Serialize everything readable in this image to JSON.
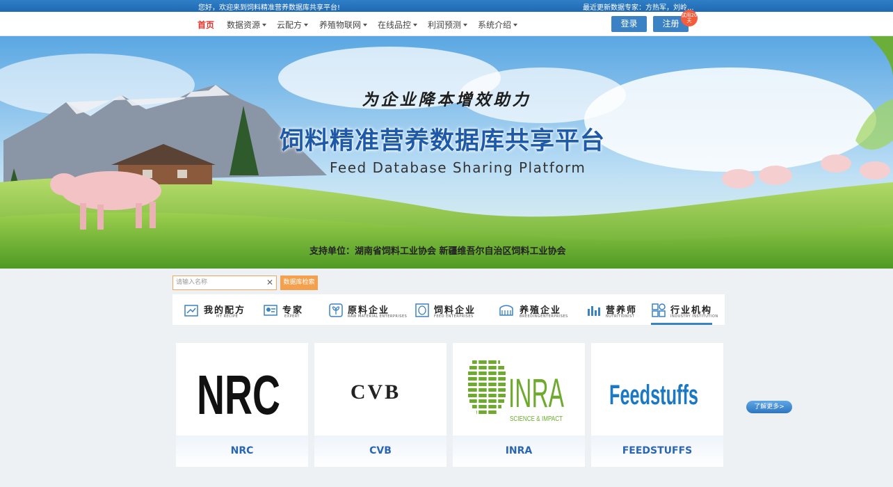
{
  "topbar": {
    "welcome": "您好，欢迎来到饲料精准营养数据库共享平台!",
    "experts": "最近更新数据专家：方热军，刘岭..."
  },
  "nav": {
    "items": [
      {
        "label": "首页",
        "active": true,
        "dropdown": false
      },
      {
        "label": "数据资源",
        "dropdown": true
      },
      {
        "label": "云配方",
        "dropdown": true
      },
      {
        "label": "养殖物联网",
        "dropdown": true
      },
      {
        "label": "在线品控",
        "dropdown": true
      },
      {
        "label": "利润预测",
        "dropdown": true
      },
      {
        "label": "系统介绍",
        "dropdown": true
      }
    ],
    "login": "登录",
    "register": "注册",
    "trial_badge": "试用20天"
  },
  "banner": {
    "slogan": "为企业降本增效助力",
    "platform_name": "饲料精准营养数据库共享平台",
    "english_name": "Feed Database Sharing Platform",
    "support": "支持单位：湖南省饲料工业协会 新疆维吾尔自治区饲料工业协会"
  },
  "search": {
    "placeholder": "请输入名称",
    "button": "数据库检索"
  },
  "tabs": [
    {
      "zh": "我的配方",
      "en": "MY RECIPE",
      "icon": "recipe-icon"
    },
    {
      "zh": "专家",
      "en": "EXPERT",
      "icon": "expert-icon"
    },
    {
      "zh": "原料企业",
      "en": "RAW MATERIAL ENTERPRISES",
      "icon": "raw-material-icon"
    },
    {
      "zh": "饲料企业",
      "en": "FEED ENTERPRISES",
      "icon": "feed-icon"
    },
    {
      "zh": "养殖企业",
      "en": "BREEDINGENTERPRISES",
      "icon": "breeding-icon"
    },
    {
      "zh": "营养师",
      "en": "NUTRITIONIST",
      "icon": "nutritionist-icon"
    },
    {
      "zh": "行业机构",
      "en": "INDUSTRY INSTITUTION",
      "icon": "institution-icon",
      "active": true
    }
  ],
  "institutions": [
    {
      "logo_text": "NRC",
      "label": "NRC"
    },
    {
      "logo_text": "CVB",
      "label": "CVB"
    },
    {
      "logo_text": "INRA",
      "logo_sub": "SCIENCE & IMPACT",
      "label": "INRA"
    },
    {
      "logo_text": "Feedstuffs",
      "label": "FEEDSTUFFS"
    }
  ],
  "more_button": "了解更多>",
  "colors": {
    "brand_blue": "#3a82c4",
    "active_red": "#e0322c",
    "search_orange": "#f5a04c",
    "label_blue": "#2a66b0"
  }
}
